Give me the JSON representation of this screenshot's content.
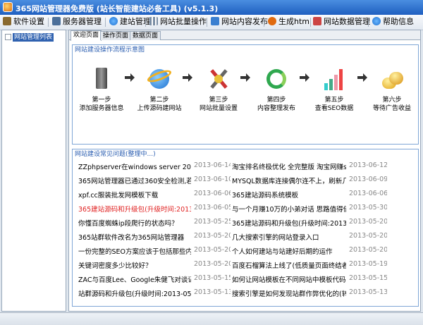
{
  "window": {
    "title": "365网站管理器免费版 (站长智能建站必备工具) (v5.1.3)"
  },
  "menu": [
    {
      "label": "软件设置",
      "icon": "wrench-icon"
    },
    {
      "label": "服务器管理",
      "icon": "server-icon"
    },
    {
      "label": "建站管理",
      "icon": "globe-icon"
    },
    {
      "label": "网站批量操作",
      "icon": "grid-icon"
    },
    {
      "label": "网站内容发布",
      "icon": "publish-icon"
    },
    {
      "label": "生成html",
      "icon": "html-icon"
    },
    {
      "label": "网站数据管理",
      "icon": "database-icon"
    },
    {
      "label": "帮助信息",
      "icon": "help-icon"
    }
  ],
  "tree": {
    "root": "网站管理列表"
  },
  "tabs": [
    "欢迎页面",
    "操作页面",
    "数据页面"
  ],
  "flow": {
    "title": "网站建设操作流程示意图",
    "steps": [
      {
        "l1": "第一步",
        "l2": "添加服务器信息"
      },
      {
        "l1": "第二步",
        "l2": "上传源码建网站"
      },
      {
        "l1": "第三步",
        "l2": "网站批量设置"
      },
      {
        "l1": "第四步",
        "l2": "内容整理发布"
      },
      {
        "l1": "第五步",
        "l2": "查看SEO数据"
      },
      {
        "l1": "第六步",
        "l2": "等待广告收益"
      }
    ]
  },
  "news": {
    "title": "网站建设常见问题(整理中...)",
    "rows": [
      {
        "t1": "ZZphpserver在windows server 2008 64位",
        "d1": "2013-06-14",
        "t2": "淘宝排名终极优化 全完整版 淘宝网赚seo",
        "d2": "2013-06-12"
      },
      {
        "t1": "365网站管理器已通过360安全检测,若被拦",
        "d1": "2013-06-10",
        "t2": "MYSQL数据库连接偶尔连不上，刷新几秒后",
        "d2": "2013-06-09"
      },
      {
        "t1": "xpf.cc服装批发网模板下载",
        "d1": "2013-06-06",
        "t2": "365建站源码系统模板",
        "d2": "2013-06-06"
      },
      {
        "t1": "365建站源码和升级包(升级时间:2013-06-",
        "d1": "2013-06-05",
        "t2": "与一个月赚10万的小弟对话 思路值得借鉴",
        "d2": "2013-05-30"
      },
      {
        "t1": "你懂百度蜘蛛ip段爬行的状态吗？",
        "d1": "2013-05-25",
        "t2": "365建站源码和升级包(升级时间:2013-05-",
        "d2": "2013-05-20"
      },
      {
        "t1": "365站群软件改名为365网站管理器",
        "d1": "2013-05-20",
        "t2": "几大搜索引擎的网站登录入口",
        "d2": "2013-05-20"
      },
      {
        "t1": "一份完整的SEO方案应该于包括那些内容",
        "d1": "2013-05-20",
        "t2": "个人如何建站与站建好后期的运作",
        "d2": "2013-05-20"
      },
      {
        "t1": "关键词密度多少比较好？",
        "d1": "2013-05-20",
        "t2": "百度石榴算法上线了(低质量页面终结者)",
        "d2": "2013-05-19"
      },
      {
        "t1": "ZAC与百度Lee、Google朱健飞对谈记录",
        "d1": "2013-05-15",
        "t2": "如何让网站模板在不同网站中模板代码不一",
        "d2": "2013-05-15"
      },
      {
        "t1": "站群源码和升级包(升级时间:2013-05-13)",
        "d1": "2013-05-13",
        "t2": "搜索引擎是如何发现站群作弊优化的(转载",
        "d2": "2013-05-13"
      }
    ]
  },
  "colors": {
    "title": "#1f5fc0",
    "accent": "#2a5db0",
    "highlight": "#e02020",
    "date": "#888888"
  }
}
